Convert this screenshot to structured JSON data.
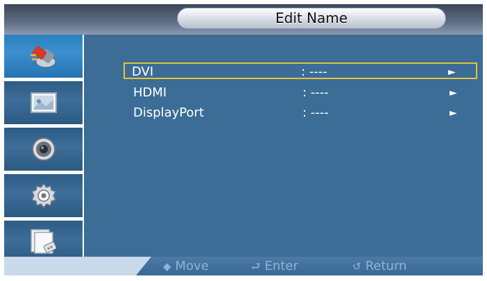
{
  "title": "Edit Name",
  "sidebar": {
    "items": [
      {
        "name": "input-icon",
        "active": true
      },
      {
        "name": "picture-icon",
        "active": false
      },
      {
        "name": "sound-icon",
        "active": false
      },
      {
        "name": "setup-icon",
        "active": false
      },
      {
        "name": "multi-control-icon",
        "active": false
      }
    ]
  },
  "menu": {
    "items": [
      {
        "label": "DVI",
        "value": ": ----",
        "arrow": "►"
      },
      {
        "label": "HDMI",
        "value": ": ----",
        "arrow": "►"
      },
      {
        "label": "DisplayPort",
        "value": ": ----",
        "arrow": "►"
      }
    ]
  },
  "footer": {
    "move_icon": "◆",
    "move": "Move",
    "enter_icon": "⮐",
    "enter": "Enter",
    "return_icon": "↺",
    "return": "Return"
  },
  "colors": {
    "background": "#3b6d96",
    "selection_border": "#e9c23a",
    "footer_text": "#8fb3d3"
  }
}
